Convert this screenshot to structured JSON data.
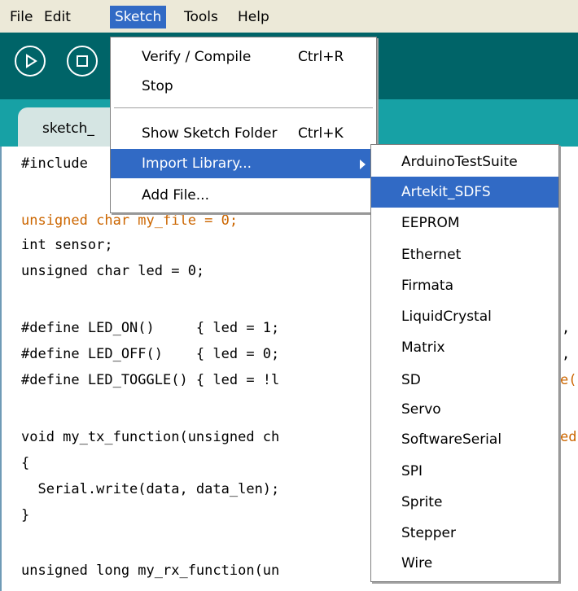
{
  "menubar": {
    "items": [
      "File",
      "Edit",
      "Sketch",
      "Tools",
      "Help"
    ],
    "active": "Sketch"
  },
  "toolbar": {
    "buttons": [
      "play-icon",
      "stop-icon"
    ],
    "background": "#006468"
  },
  "tab": {
    "label": "sketch_"
  },
  "code": {
    "lines": [
      "#include",
      "",
      "unsigned char my_file = 0;",
      "int sensor;",
      "unsigned char led = 0;",
      "",
      "#define LED_ON()     { led = 1;",
      "#define LED_OFF()    { led = 0;",
      "#define LED_TOGGLE() { led = !l",
      "",
      "void my_tx_function(unsigned ch",
      "{",
      "  Serial.write(data, data_len);",
      "}",
      "",
      "unsigned long my_rx_function(un"
    ],
    "right_fragments": [
      ",",
      ",",
      "e(",
      "ed"
    ]
  },
  "sketch_menu": {
    "items": [
      {
        "label": "Verify / Compile",
        "shortcut": "Ctrl+R"
      },
      {
        "label": "Stop",
        "shortcut": ""
      },
      {
        "label": "Show Sketch Folder",
        "shortcut": "Ctrl+K"
      },
      {
        "label": "Import Library...",
        "shortcut": ""
      },
      {
        "label": "Add File...",
        "shortcut": ""
      }
    ],
    "highlighted": "Import Library..."
  },
  "library_menu": {
    "items": [
      "ArduinoTestSuite",
      "Artekit_SDFS",
      "EEPROM",
      "Ethernet",
      "Firmata",
      "LiquidCrystal",
      "Matrix",
      "SD",
      "Servo",
      "SoftwareSerial",
      "SPI",
      "Sprite",
      "Stepper",
      "Wire"
    ],
    "highlighted": "Artekit_SDFS"
  },
  "colors": {
    "accent": "#316ac5",
    "keyword": "#cc6600",
    "tab_strip": "#17a1a5"
  }
}
